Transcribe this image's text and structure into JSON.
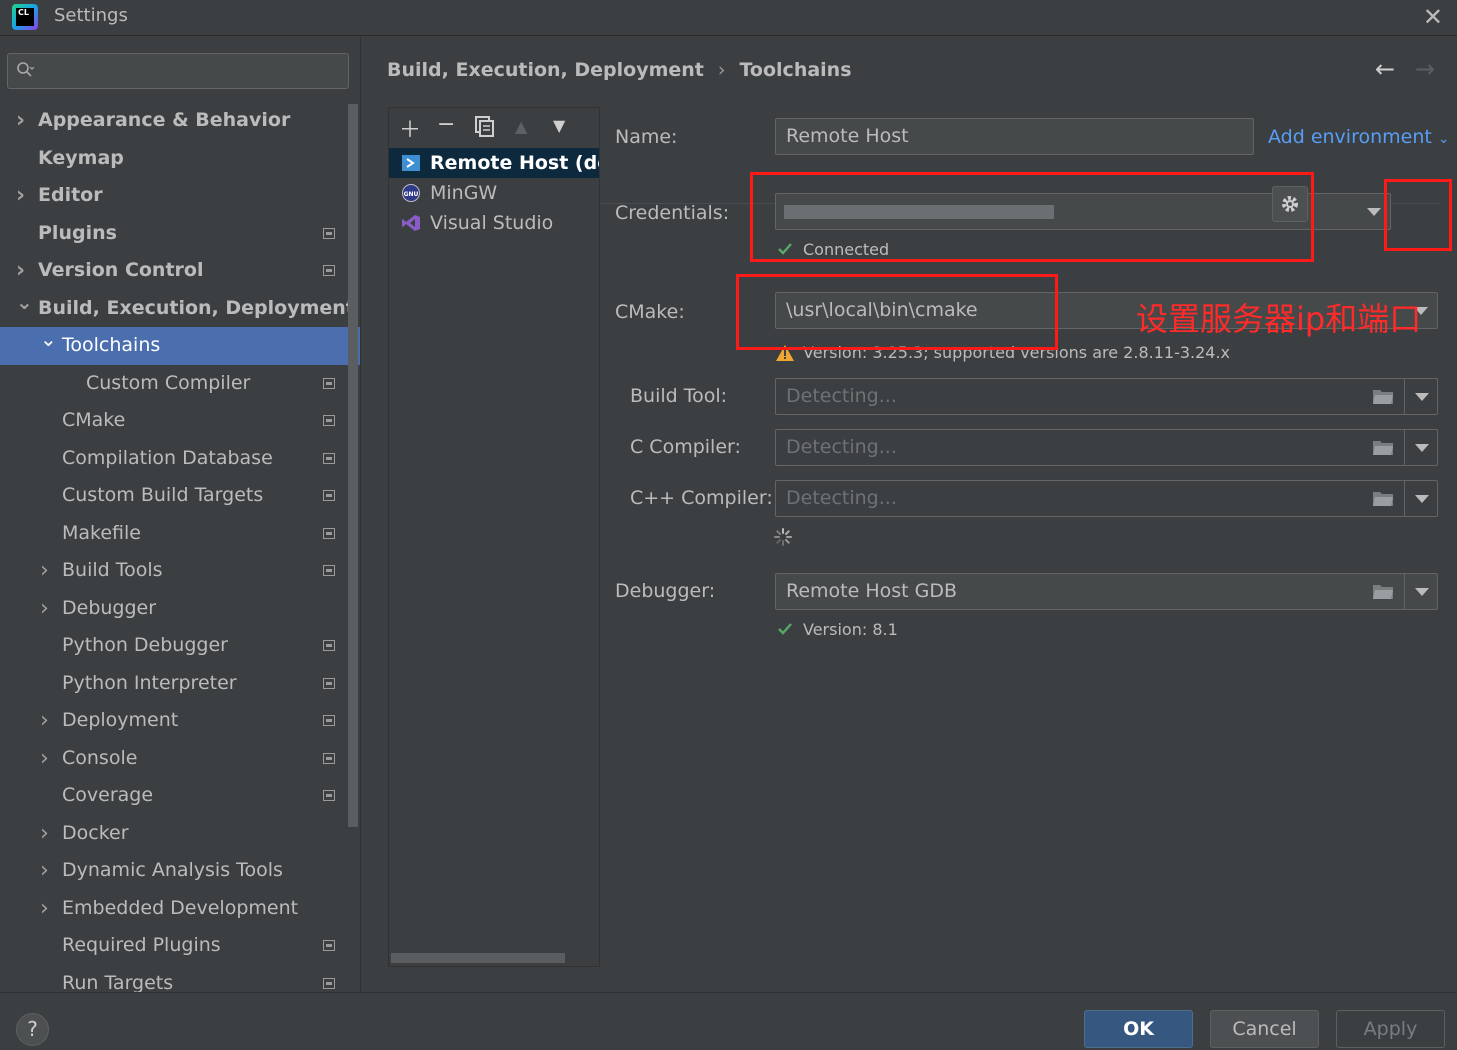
{
  "window": {
    "title": "Settings",
    "app_icon_text": "CL"
  },
  "search": {
    "placeholder": ""
  },
  "sidebar": {
    "items": [
      {
        "label": "Appearance & Behavior",
        "level": 0,
        "expandable": true,
        "expanded": false,
        "bold": true,
        "project": false
      },
      {
        "label": "Keymap",
        "level": 0,
        "expandable": false,
        "bold": true,
        "project": false
      },
      {
        "label": "Editor",
        "level": 0,
        "expandable": true,
        "expanded": false,
        "bold": true,
        "project": false
      },
      {
        "label": "Plugins",
        "level": 0,
        "expandable": false,
        "bold": true,
        "project": true
      },
      {
        "label": "Version Control",
        "level": 0,
        "expandable": true,
        "expanded": false,
        "bold": true,
        "project": true
      },
      {
        "label": "Build, Execution, Deployment",
        "level": 0,
        "expandable": true,
        "expanded": true,
        "bold": true,
        "project": false
      },
      {
        "label": "Toolchains",
        "level": 1,
        "expandable": true,
        "expanded": true,
        "selected": true,
        "project": false
      },
      {
        "label": "Custom Compiler",
        "level": 2,
        "expandable": false,
        "project": true
      },
      {
        "label": "CMake",
        "level": 1,
        "expandable": false,
        "project": true
      },
      {
        "label": "Compilation Database",
        "level": 1,
        "expandable": false,
        "project": true
      },
      {
        "label": "Custom Build Targets",
        "level": 1,
        "expandable": false,
        "project": true
      },
      {
        "label": "Makefile",
        "level": 1,
        "expandable": false,
        "project": true
      },
      {
        "label": "Build Tools",
        "level": 1,
        "expandable": true,
        "expanded": false,
        "project": true
      },
      {
        "label": "Debugger",
        "level": 1,
        "expandable": true,
        "expanded": false,
        "project": false
      },
      {
        "label": "Python Debugger",
        "level": 1,
        "expandable": false,
        "project": true
      },
      {
        "label": "Python Interpreter",
        "level": 1,
        "expandable": false,
        "project": true
      },
      {
        "label": "Deployment",
        "level": 1,
        "expandable": true,
        "expanded": false,
        "project": true
      },
      {
        "label": "Console",
        "level": 1,
        "expandable": true,
        "expanded": false,
        "project": true
      },
      {
        "label": "Coverage",
        "level": 1,
        "expandable": false,
        "project": true
      },
      {
        "label": "Docker",
        "level": 1,
        "expandable": true,
        "expanded": false,
        "project": false
      },
      {
        "label": "Dynamic Analysis Tools",
        "level": 1,
        "expandable": true,
        "expanded": false,
        "project": false
      },
      {
        "label": "Embedded Development",
        "level": 1,
        "expandable": true,
        "expanded": false,
        "project": false
      },
      {
        "label": "Required Plugins",
        "level": 1,
        "expandable": false,
        "project": true
      },
      {
        "label": "Run Targets",
        "level": 1,
        "expandable": false,
        "project": true
      }
    ]
  },
  "breadcrumb": {
    "parent": "Build, Execution, Deployment",
    "separator": "›",
    "current": "Toolchains"
  },
  "toolchains": {
    "items": [
      {
        "label": "Remote Host (defa",
        "icon": "remote-host-icon",
        "selected": true
      },
      {
        "label": "MinGW",
        "icon": "gnu-icon",
        "selected": false
      },
      {
        "label": "Visual Studio",
        "icon": "visual-studio-icon",
        "selected": false
      }
    ]
  },
  "form": {
    "name_label": "Name:",
    "name_value": "Remote Host",
    "add_environment": "Add environment",
    "credentials_label": "Credentials:",
    "credentials_status": "Connected",
    "cmake_label": "CMake:",
    "cmake_value": "\\usr\\local\\bin\\cmake",
    "cmake_warning": "Version: 3.25.3; supported versions are 2.8.11-3.24.x",
    "build_tool_label": "Build Tool:",
    "build_tool_placeholder": "Detecting...",
    "c_compiler_label": "C Compiler:",
    "c_compiler_placeholder": "Detecting...",
    "cpp_compiler_label": "C++ Compiler:",
    "cpp_compiler_placeholder": "Detecting...",
    "debugger_label": "Debugger:",
    "debugger_value": "Remote Host GDB",
    "debugger_version": "Version: 8.1"
  },
  "annotation": {
    "text": "设置服务器ip和端口",
    "color": "#ff2a2a"
  },
  "buttons": {
    "ok": "OK",
    "cancel": "Cancel",
    "apply": "Apply",
    "help": "?"
  },
  "colors": {
    "selection": "#4b6eaf",
    "link": "#589df6",
    "primary_button": "#365880",
    "success": "#59a869",
    "warning": "#f0a732"
  }
}
